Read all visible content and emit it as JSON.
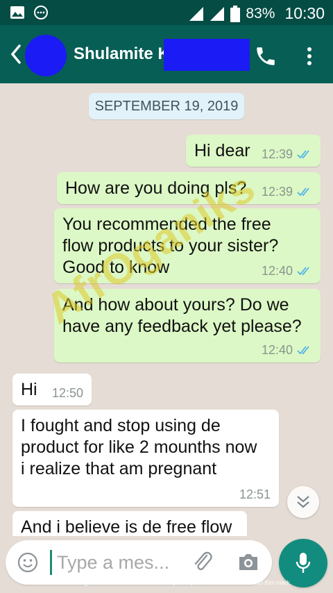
{
  "status_bar": {
    "icons": [
      "image-icon",
      "chat-bubble-icon",
      "signal-icon",
      "signal-icon",
      "battery-icon"
    ],
    "battery": "83%",
    "time": "10:30"
  },
  "header": {
    "contact_name": "Shulamite K",
    "icons": [
      "back-arrow-icon",
      "phone-icon",
      "more-vert-icon"
    ]
  },
  "chat": {
    "date_chip": "SEPTEMBER 19, 2019",
    "messages": [
      {
        "direction": "out",
        "text": "Hi dear",
        "time": "12:39",
        "status": "read"
      },
      {
        "direction": "out",
        "text": "How are you doing pls?",
        "time": "12:39",
        "status": "read"
      },
      {
        "direction": "out",
        "text": "You recommended the free flow products to your sister? Good to know",
        "lines": [
          "You recommended the free",
          "flow products to your sister?",
          "Good to know"
        ],
        "time": "12:40",
        "status": "read"
      },
      {
        "direction": "out",
        "text": "And how about yours? Do we have any feedback yet please?",
        "lines": [
          "And how about yours? Do we",
          "have any feedback yet please?"
        ],
        "time": "12:40",
        "status": "read"
      },
      {
        "direction": "in",
        "text": "Hi",
        "time": "12:50"
      },
      {
        "direction": "in",
        "text": "I fought and stop using de product for like 2 mounths now i realize  that am pregnant",
        "lines": [
          "I fought and stop using de",
          "product for like 2 mounths now",
          "i realize  that am pregnant"
        ],
        "time": "12:51"
      },
      {
        "direction": "in",
        "text": "And i believe is de free flow",
        "time": ""
      }
    ],
    "watermark": "AfrOganiks"
  },
  "composer": {
    "placeholder": "Type a mes...",
    "icons": [
      "emoji-icon",
      "attach-icon",
      "camera-icon",
      "mic-icon"
    ]
  },
  "footer_note": "Processed using the free version of Watermarkly. The paid version does not add this mark."
}
